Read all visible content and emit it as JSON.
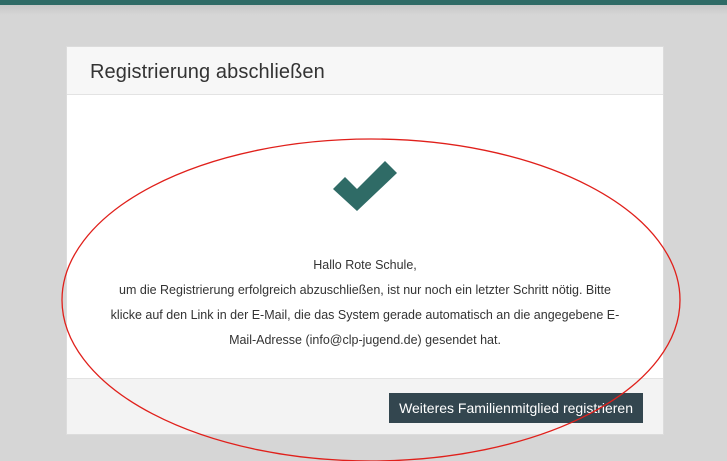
{
  "card": {
    "title": "Registrierung abschließen",
    "greeting": "Hallo Rote Schule,",
    "message_lines": [
      "um die Registrierung erfolgreich abzuschließen, ist nur noch ein letzter Schritt nötig. Bitte",
      "klicke auf den Link in der E-Mail, die das System gerade automatisch an die angegebene E-",
      "Mail-Adresse (info@clp-jugend.de) gesendet hat."
    ],
    "button_label": "Weiteres Familienmitglied registrieren"
  },
  "icons": {
    "success": "checkmark-icon"
  },
  "colors": {
    "accent": "#2f6b66",
    "button_bg": "#33464f",
    "annotation": "#e0201b"
  }
}
